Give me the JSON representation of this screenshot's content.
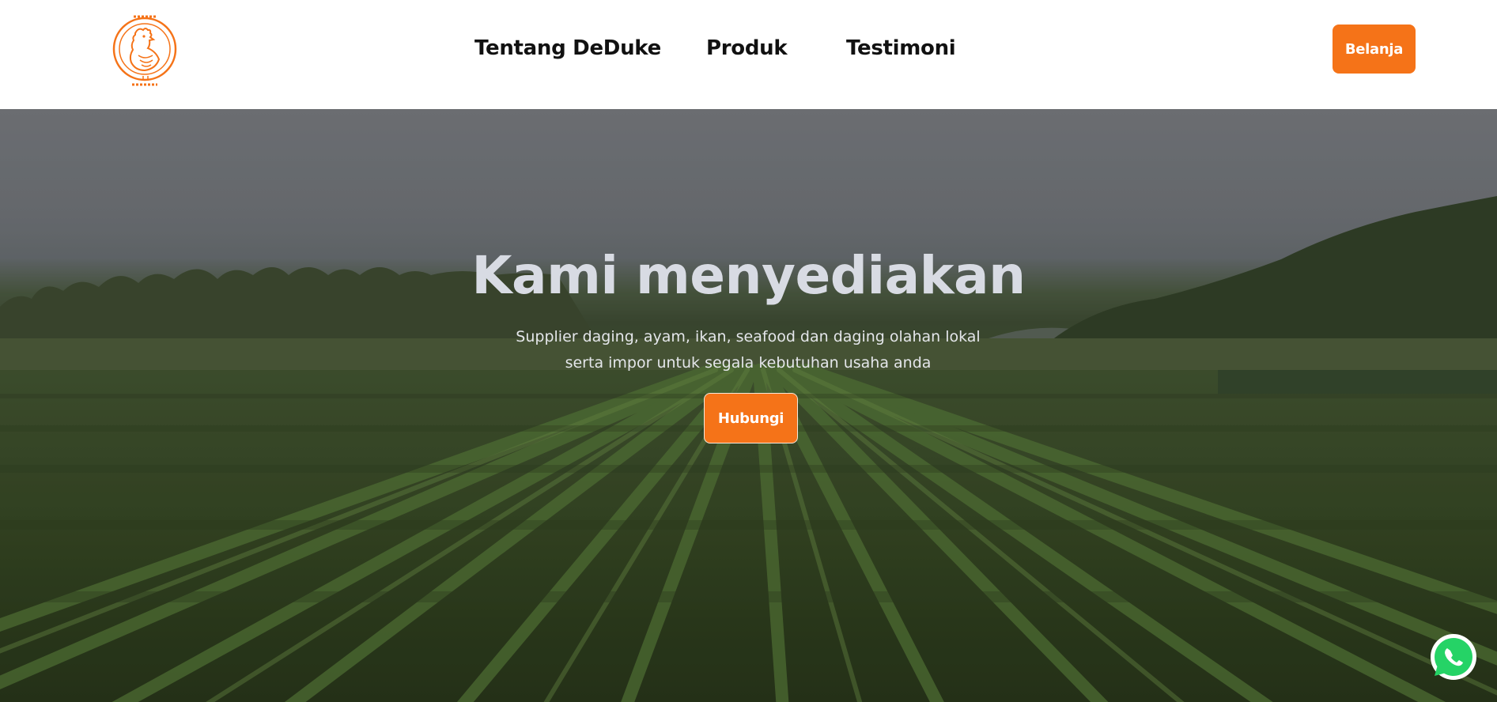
{
  "header": {
    "logo_icon": "chicken-badge-logo",
    "brand_color": "#f57318",
    "nav": [
      {
        "label": "Tentang DeDuke"
      },
      {
        "label": "Produk"
      },
      {
        "label": "Testimoni"
      }
    ],
    "shop_button": "Belanja"
  },
  "hero": {
    "title": "Kami menyediakan",
    "subtitle_line1": "Supplier daging, ayam, ikan, seafood dan daging olahan lokal",
    "subtitle_line2": "serta impor untuk segala kebutuhan usaha anda",
    "contact_button": "Hubungi",
    "background": "farm-field-image"
  },
  "floating": {
    "whatsapp_icon": "whatsapp-icon",
    "whatsapp_color": "#25d366"
  }
}
